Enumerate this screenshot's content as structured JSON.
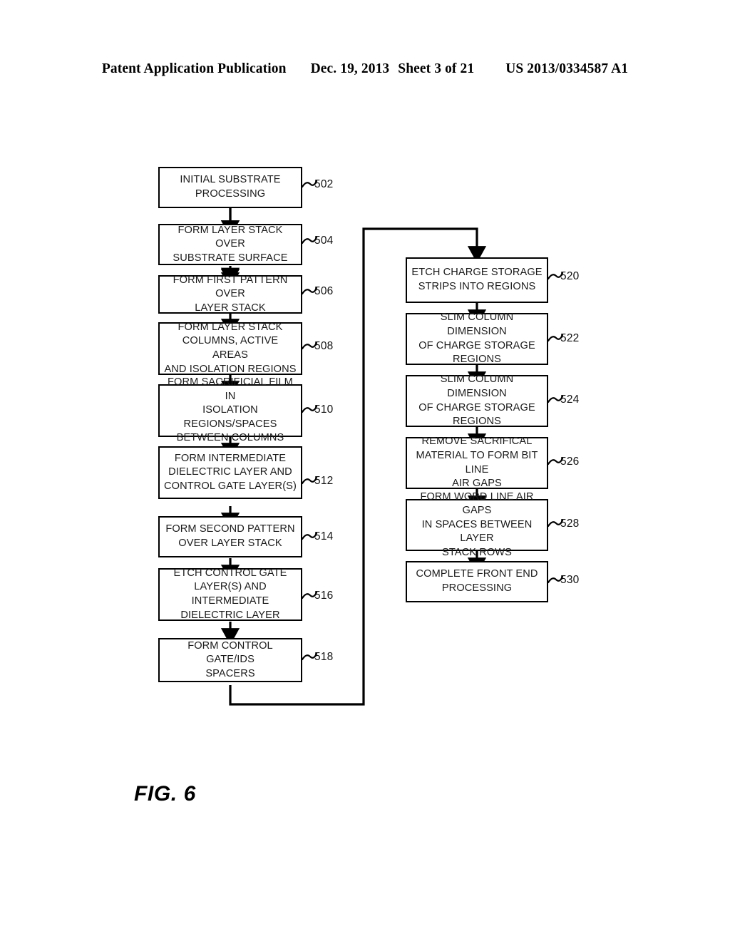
{
  "header": {
    "publication": "Patent Application Publication",
    "date": "Dec. 19, 2013",
    "sheet": "Sheet 3 of 21",
    "patent_number": "US 2013/0334587 A1"
  },
  "figure": {
    "caption": "FIG. 6",
    "left_column": [
      {
        "ref": "502",
        "text": "INITIAL SUBSTRATE\nPROCESSING"
      },
      {
        "ref": "504",
        "text": "FORM LAYER STACK OVER\nSUBSTRATE SURFACE"
      },
      {
        "ref": "506",
        "text": "FORM FIRST PATTERN OVER\nLAYER STACK"
      },
      {
        "ref": "508",
        "text": "FORM LAYER STACK\nCOLUMNS, ACTIVE AREAS\nAND ISOLATION REGIONS"
      },
      {
        "ref": "510",
        "text": "FORM SACRIFICIAL FILM IN\nISOLATION REGIONS/SPACES\nBETWEEN COLUMNS"
      },
      {
        "ref": "512",
        "text": "FORM INTERMEDIATE\nDIELECTRIC LAYER AND\nCONTROL GATE LAYER(S)"
      },
      {
        "ref": "514",
        "text": "FORM SECOND PATTERN\nOVER LAYER STACK"
      },
      {
        "ref": "516",
        "text": "ETCH CONTROL GATE\nLAYER(S) AND INTERMEDIATE\nDIELECTRIC LAYER"
      },
      {
        "ref": "518",
        "text": "FORM CONTROL GATE/IDS\nSPACERS"
      }
    ],
    "right_column": [
      {
        "ref": "520",
        "text": "ETCH CHARGE STORAGE\nSTRIPS INTO REGIONS"
      },
      {
        "ref": "522",
        "text": "SLIM COLUMN DIMENSION\nOF CHARGE STORAGE\nREGIONS"
      },
      {
        "ref": "524",
        "text": "SLIM COLUMN DIMENSION\nOF CHARGE STORAGE\nREGIONS"
      },
      {
        "ref": "526",
        "text": "REMOVE SACRIFICAL\nMATERIAL TO FORM BIT LINE\nAIR GAPS"
      },
      {
        "ref": "528",
        "text": "FORM WORD LINE AIR GAPS\nIN SPACES BETWEEN LAYER\nSTACK ROWS"
      },
      {
        "ref": "530",
        "text": "COMPLETE FRONT END\nPROCESSING"
      }
    ]
  },
  "colors": {
    "ink": "#000000",
    "page": "#ffffff"
  }
}
